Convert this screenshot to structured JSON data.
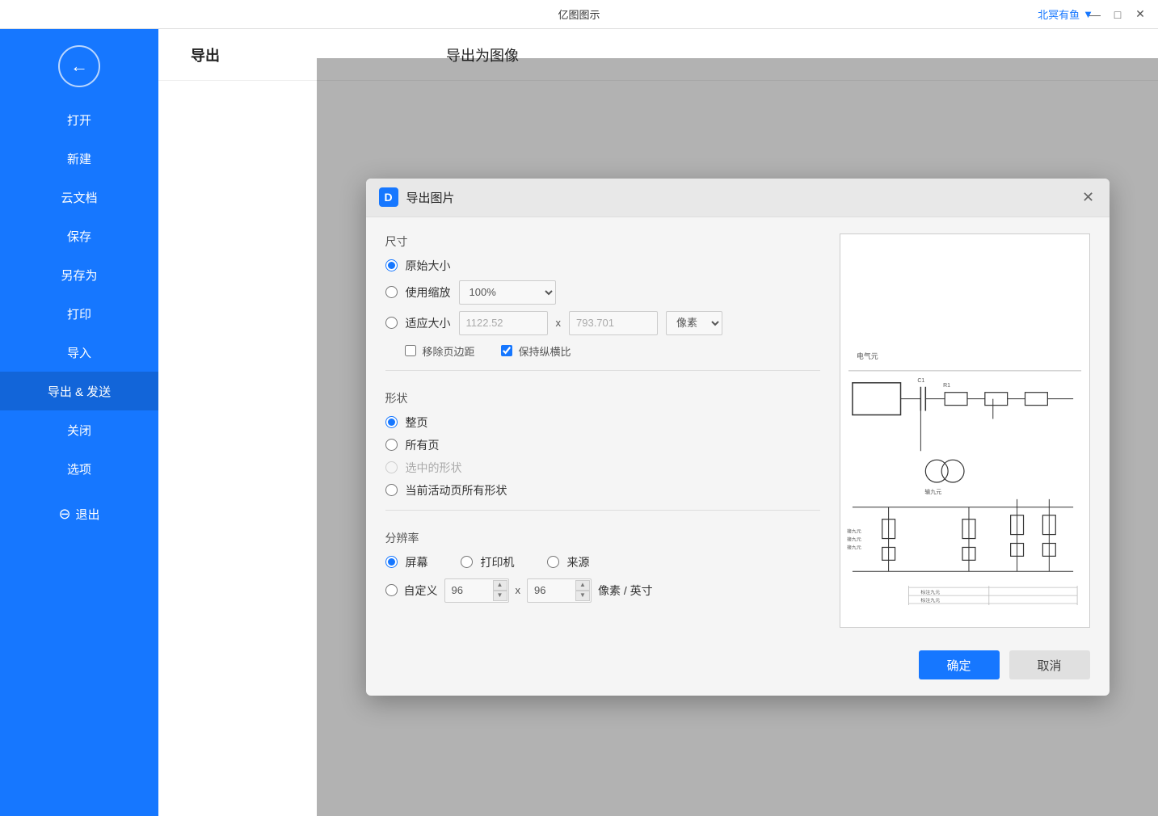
{
  "app": {
    "title": "亿图图示",
    "user": "北冥有鱼",
    "user_dropdown_icon": "▼"
  },
  "titlebar": {
    "minimize": "—",
    "maximize": "□",
    "close": "✕"
  },
  "sidebar": {
    "back_icon": "←",
    "items": [
      {
        "id": "open",
        "label": "打开",
        "active": false
      },
      {
        "id": "new",
        "label": "新建",
        "active": false
      },
      {
        "id": "cloud",
        "label": "云文档",
        "active": false
      },
      {
        "id": "save",
        "label": "保存",
        "active": false
      },
      {
        "id": "saveas",
        "label": "另存为",
        "active": false
      },
      {
        "id": "print",
        "label": "打印",
        "active": false
      },
      {
        "id": "import",
        "label": "导入",
        "active": false
      },
      {
        "id": "export",
        "label": "导出 & 发送",
        "active": true
      },
      {
        "id": "close",
        "label": "关闭",
        "active": false
      },
      {
        "id": "options",
        "label": "选项",
        "active": false
      },
      {
        "id": "exit",
        "label": "退出",
        "active": false
      }
    ]
  },
  "content": {
    "header_title": "导出",
    "header_subtitle": "导出为图像"
  },
  "dialog": {
    "title": "导出图片",
    "icon_text": "D",
    "close_icon": "✕",
    "sections": {
      "size": {
        "label": "尺寸",
        "radio_original": "原始大小",
        "radio_zoom": "使用缩放",
        "zoom_value": "100%",
        "radio_fit": "适应大小",
        "fit_width": "1122.52",
        "fit_height": "793.701",
        "fit_unit": "像素",
        "x_label": "x",
        "checkbox_remove_margin": "移除页边距",
        "checkbox_keep_ratio": "保持纵横比",
        "remove_margin_checked": false,
        "keep_ratio_checked": true
      },
      "shape": {
        "label": "形状",
        "radio_whole_page": "整页",
        "radio_all_pages": "所有页",
        "radio_selected": "选中的形状",
        "radio_current_active": "当前活动页所有形状",
        "selected_enabled": false
      },
      "resolution": {
        "label": "分辨率",
        "radio_screen": "屏幕",
        "radio_printer": "打印机",
        "radio_source": "来源",
        "radio_custom": "自定义",
        "custom_x": "96",
        "custom_y": "96",
        "unit_label": "像素 / 英寸"
      }
    },
    "buttons": {
      "confirm": "确定",
      "cancel": "取消"
    }
  }
}
